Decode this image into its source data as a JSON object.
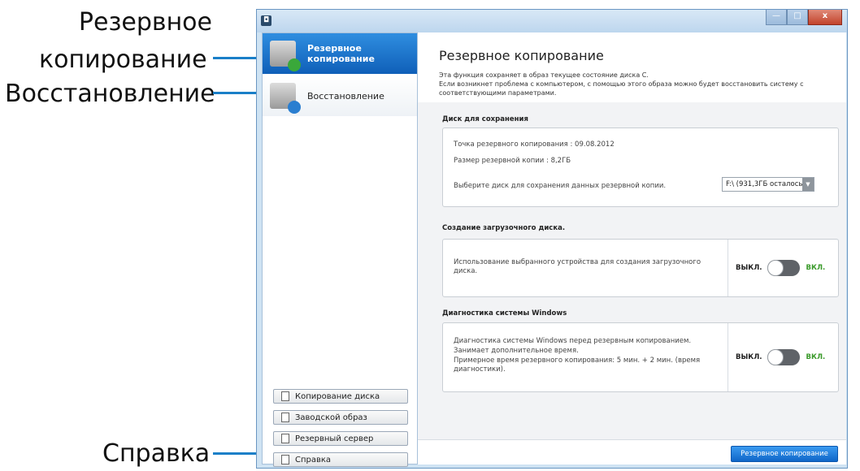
{
  "callouts": {
    "backup_line1": "Резервное",
    "backup_line2": "копирование",
    "restore": "Восстановление",
    "help": "Справка"
  },
  "window": {
    "minimize_glyph": "—",
    "maximize_glyph": "□",
    "close_glyph": "x"
  },
  "sidebar": {
    "items": [
      {
        "label_line1": "Резервное",
        "label_line2": "копирование",
        "active": true
      },
      {
        "label": "Восстановление",
        "active": false
      }
    ],
    "buttons": [
      {
        "label": "Копирование диска"
      },
      {
        "label": "Заводской образ"
      },
      {
        "label": "Резервный сервер"
      },
      {
        "label": "Справка"
      }
    ]
  },
  "main": {
    "title": "Резервное копирование",
    "description_line1": "Эта функция сохраняет в образ текущее состояние диска C.",
    "description_line2": "Если возникнет проблема с компьютером, с помощью этого образа можно будет восстановить систему с соответствующими параметрами.",
    "disk_section": {
      "title": "Диск для сохранения",
      "restore_point": "Точка резервного копирования : 09.08.2012",
      "backup_size": "Размер резервной копии : 8,2ГБ",
      "select_prompt": "Выберите диск для сохранения данных резервной копии.",
      "select_value": "F:\\ (931,3ГБ осталось)"
    },
    "boot_section": {
      "title": "Создание загрузочного диска.",
      "description": "Использование выбранного устройства для создания загрузочного диска.",
      "off_label": "ВЫКЛ.",
      "on_label": "ВКЛ.",
      "state": "off"
    },
    "diag_section": {
      "title": "Диагностика системы Windows",
      "line1": "Диагностика системы Windows перед резервным копированием.",
      "line2": "Занимает дополнительное время.",
      "line3": "Примерное время резервного копирования: 5 мин. + 2 мин. (время диагностики).",
      "off_label": "ВЫКЛ.",
      "on_label": "ВКЛ.",
      "state": "off"
    },
    "primary_button": "Резервное копирование"
  },
  "colors": {
    "accent": "#1a7fc8",
    "on_green": "#3a9a2a"
  }
}
